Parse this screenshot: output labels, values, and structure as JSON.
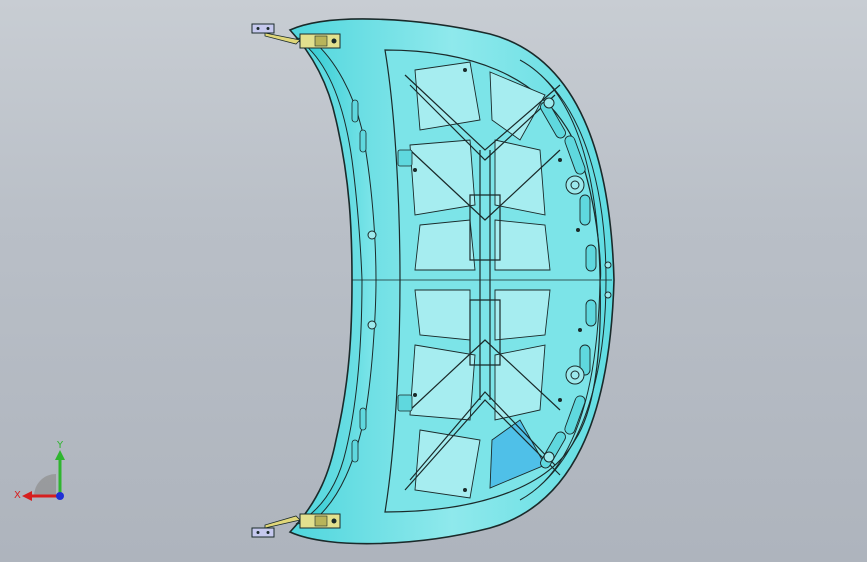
{
  "viewport": {
    "background_top": "#c8cdd3",
    "background_bottom": "#aeb4bd"
  },
  "model": {
    "part": "hood-inner-panel",
    "fill_color": "#66e0e6",
    "fill_light": "#a8eef0",
    "edge_color": "#1a2a2a",
    "mount_color": "#d8d88a"
  },
  "triad": {
    "x_label": "X",
    "y_label": "Y",
    "x_color": "#d61f1f",
    "y_color": "#2fb52f",
    "z_color": "#1f2fd6"
  }
}
